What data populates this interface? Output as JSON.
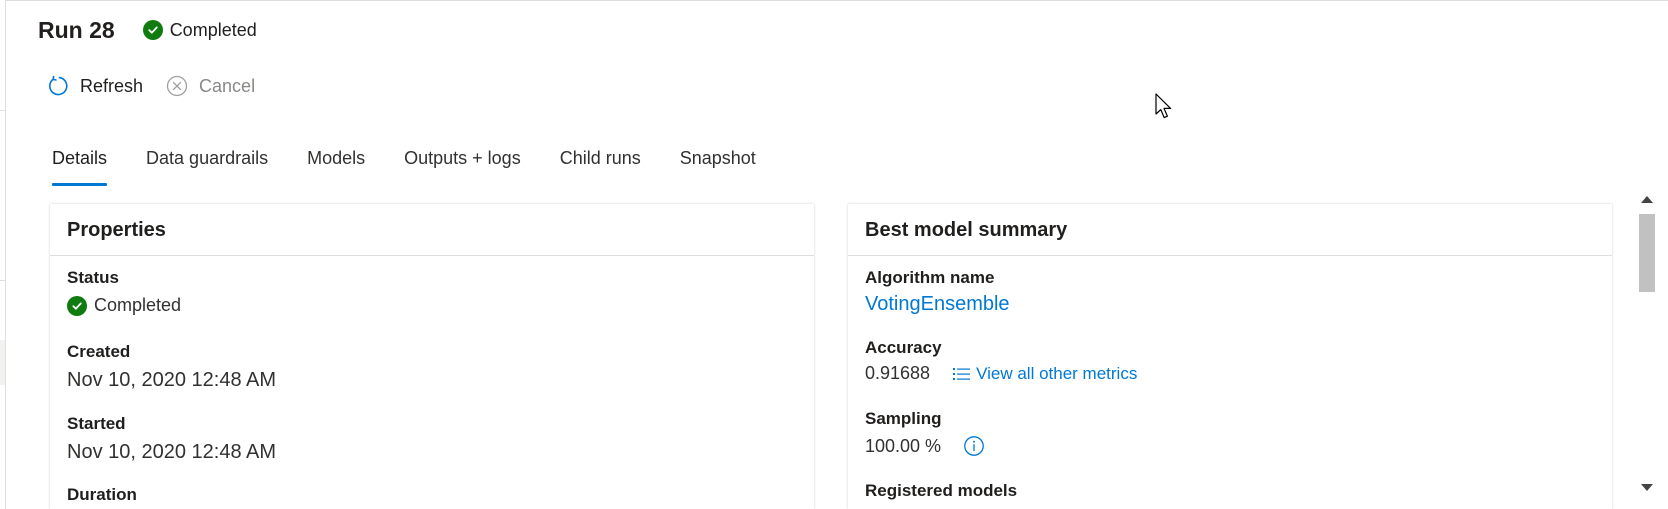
{
  "header": {
    "title": "Run 28",
    "status": "Completed"
  },
  "toolbar": {
    "refresh_label": "Refresh",
    "cancel_label": "Cancel"
  },
  "tabs": [
    {
      "label": "Details",
      "active": true
    },
    {
      "label": "Data guardrails",
      "active": false
    },
    {
      "label": "Models",
      "active": false
    },
    {
      "label": "Outputs + logs",
      "active": false
    },
    {
      "label": "Child runs",
      "active": false
    },
    {
      "label": "Snapshot",
      "active": false
    }
  ],
  "properties": {
    "title": "Properties",
    "status_label": "Status",
    "status_value": "Completed",
    "created_label": "Created",
    "created_value": "Nov 10, 2020 12:48 AM",
    "started_label": "Started",
    "started_value": "Nov 10, 2020 12:48 AM",
    "duration_label": "Duration"
  },
  "best_model": {
    "title": "Best model summary",
    "algorithm_label": "Algorithm name",
    "algorithm_value": "VotingEnsemble",
    "accuracy_label": "Accuracy",
    "accuracy_value": "0.91688",
    "metrics_link": "View all other metrics",
    "sampling_label": "Sampling",
    "sampling_value": "100.00 %",
    "registered_label": "Registered models"
  },
  "colors": {
    "accent": "#0078d4",
    "success": "#107c10",
    "disabled": "#8a8886"
  }
}
